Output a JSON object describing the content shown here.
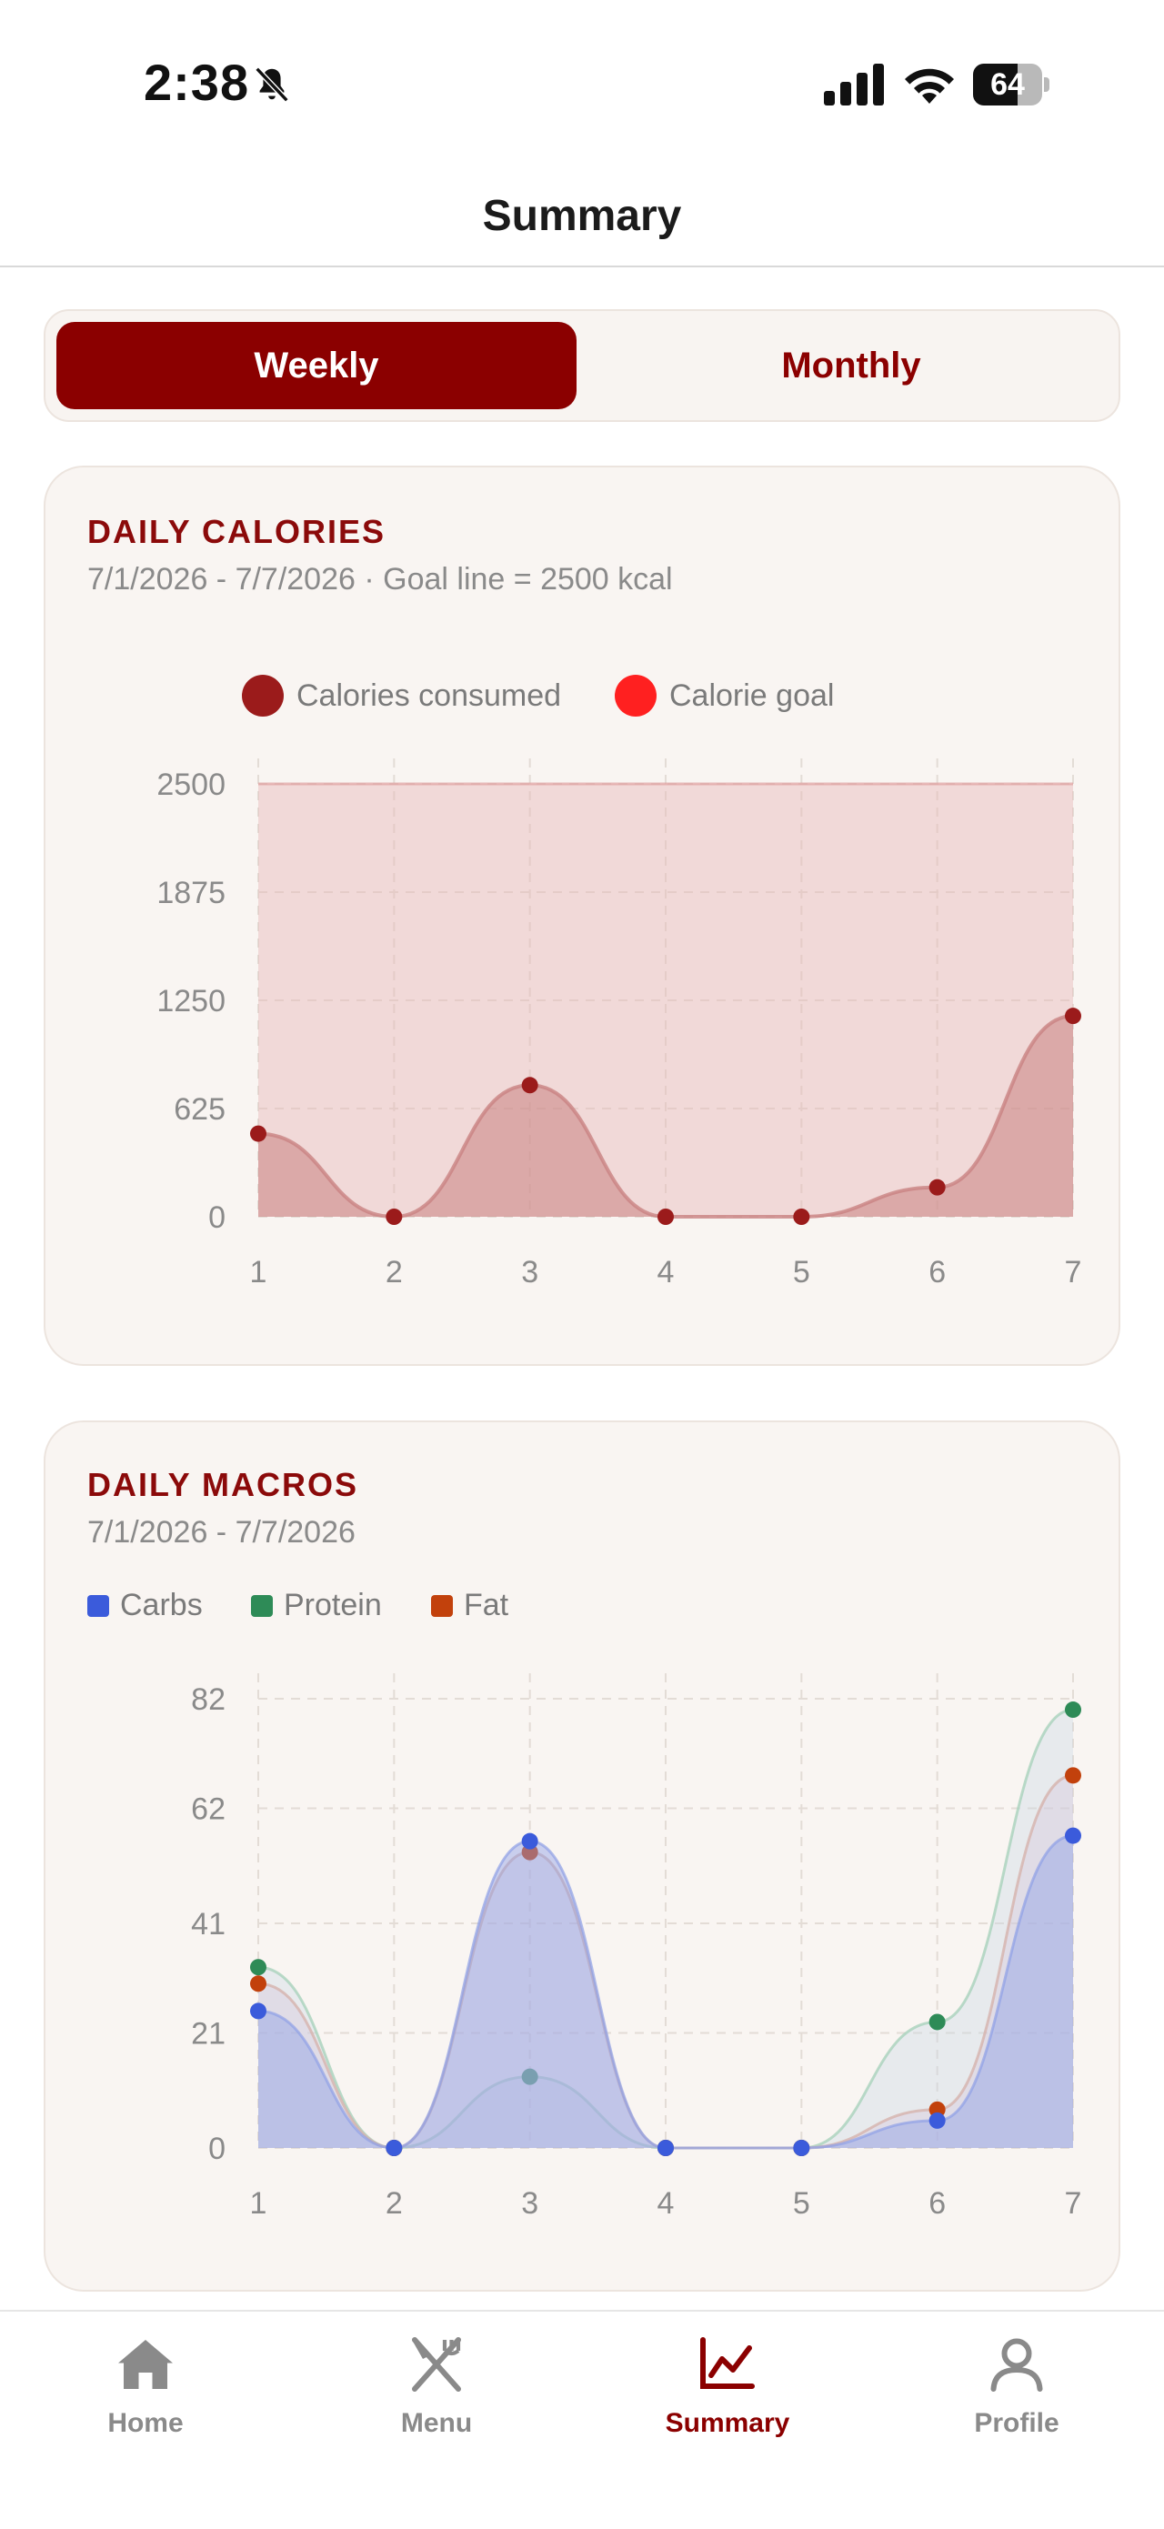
{
  "status_bar": {
    "time": "2:38",
    "battery": "64",
    "battery_level": 0.64
  },
  "header": {
    "title": "Summary"
  },
  "segments": {
    "weekly": "Weekly",
    "monthly": "Monthly",
    "selected": "Weekly"
  },
  "calories_card": {
    "title": "DAILY CALORIES",
    "subtitle": "7/1/2026 - 7/7/2026 · Goal line = 2500 kcal",
    "legend": [
      "Calories consumed",
      "Calorie goal"
    ]
  },
  "macros_card": {
    "title": "DAILY MACROS",
    "subtitle": "7/1/2026 - 7/7/2026",
    "legend": [
      "Carbs",
      "Protein",
      "Fat"
    ]
  },
  "chart_data": [
    {
      "type": "area",
      "x": [
        "1",
        "2",
        "3",
        "4",
        "5",
        "6",
        "7"
      ],
      "yticks": [
        "0",
        "625",
        "1250",
        "1875",
        "2500"
      ],
      "ylim": [
        0,
        2500
      ],
      "grid": true,
      "legend_placement": "top",
      "series": [
        {
          "name": "Calories consumed",
          "values": [
            480,
            0,
            760,
            0,
            0,
            170,
            1160
          ],
          "color": "#9b1b1b"
        },
        {
          "name": "Calorie goal",
          "values": [
            2500,
            2500,
            2500,
            2500,
            2500,
            2500,
            2500
          ],
          "color": "#ff2020"
        }
      ]
    },
    {
      "type": "area",
      "x": [
        "1",
        "2",
        "3",
        "4",
        "5",
        "6",
        "7"
      ],
      "yticks": [
        "0",
        "21",
        "41",
        "62",
        "82"
      ],
      "ylim": [
        0,
        82
      ],
      "grid": true,
      "legend_placement": "top-left",
      "series": [
        {
          "name": "Carbs",
          "values": [
            25,
            0,
            56,
            0,
            0,
            5,
            57
          ],
          "color": "#3b5bdb"
        },
        {
          "name": "Protein",
          "values": [
            33,
            0,
            13,
            0,
            0,
            23,
            80
          ],
          "color": "#2e8b57"
        },
        {
          "name": "Fat",
          "values": [
            30,
            0,
            54,
            0,
            0,
            7,
            68
          ],
          "color": "#c2410c"
        }
      ]
    }
  ],
  "tabs": [
    {
      "label": "Home",
      "icon": "home-icon",
      "active": false
    },
    {
      "label": "Menu",
      "icon": "menu-fork-knife-icon",
      "active": false
    },
    {
      "label": "Summary",
      "icon": "chart-line-icon",
      "active": true
    },
    {
      "label": "Profile",
      "icon": "person-icon",
      "active": false
    }
  ],
  "colors": {
    "accent": "#8b0000",
    "card_bg": "#f9f5f2",
    "muted": "#8a8a8a"
  }
}
